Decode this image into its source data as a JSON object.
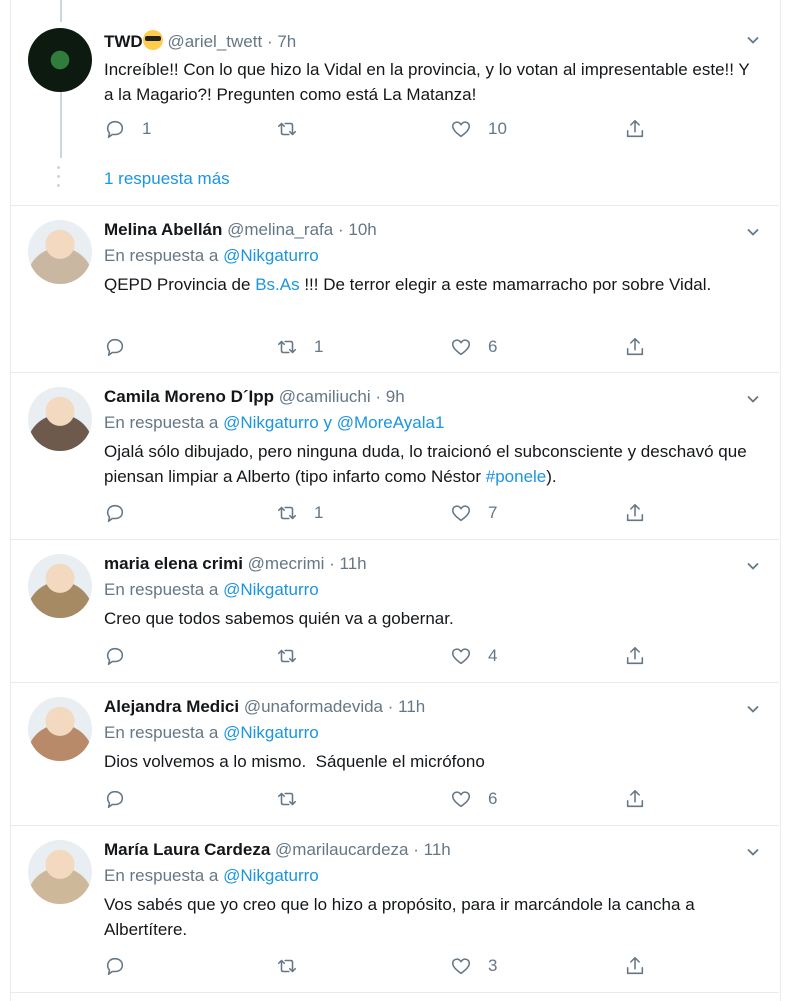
{
  "thread": {
    "more_replies": "1 respuesta más"
  },
  "tweets": [
    {
      "name": "TWD",
      "handle": "@ariel_twett",
      "dot": "·",
      "time": "7h",
      "reply_label": "",
      "reply_to": "",
      "reply_conj": "",
      "reply_to_2": "",
      "text_html": "Increíble!! Con lo que hizo la Vidal en la provincia, y lo votan al impresentable este!! Y a la Magario?! Pregunten como está La Matanza!",
      "replies": "1",
      "retweets": "",
      "likes": "10",
      "avatar_color": "#0e2a14"
    },
    {
      "name": "Melina Abellán",
      "handle": "@melina_rafa",
      "dot": "·",
      "time": "10h",
      "reply_label": "En respuesta a",
      "reply_to": "@Nikgaturro",
      "reply_conj": "",
      "reply_to_2": "",
      "text_html": "QEPD Provincia de <span class=\"link\">Bs.As</span> !!! De terror elegir a este mamarracho por sobre Vidal.",
      "replies": "",
      "retweets": "1",
      "likes": "6",
      "avatar_color": "#c9b7a2"
    },
    {
      "name": "Camila Moreno D´Ipp",
      "handle": "@camiliuchi",
      "dot": "·",
      "time": "9h",
      "reply_label": "En respuesta a",
      "reply_to": "@Nikgaturro",
      "reply_conj": "y",
      "reply_to_2": "@MoreAyala1",
      "text_html": "Ojalá sólo dibujado, pero ninguna duda, lo traicionó el subconsciente y deschavó que piensan limpiar a Alberto (tipo infarto como Néstor <span class=\"link\">#ponele</span>).",
      "replies": "",
      "retweets": "1",
      "likes": "7",
      "avatar_color": "#6d5a4c"
    },
    {
      "name": "maria elena crimi",
      "handle": "@mecrimi",
      "dot": "·",
      "time": "11h",
      "reply_label": "En respuesta a",
      "reply_to": "@Nikgaturro",
      "reply_conj": "",
      "reply_to_2": "",
      "text_html": "Creo que todos sabemos quién va a gobernar.",
      "replies": "",
      "retweets": "",
      "likes": "4",
      "avatar_color": "#a58a63"
    },
    {
      "name": "Alejandra Medici",
      "handle": "@unaformadevida",
      "dot": "·",
      "time": "11h",
      "reply_label": "En respuesta a",
      "reply_to": "@Nikgaturro",
      "reply_conj": "",
      "reply_to_2": "",
      "text_html": "Dios volvemos a lo mismo.&nbsp; Sáquenle el micrófono",
      "replies": "",
      "retweets": "",
      "likes": "6",
      "avatar_color": "#b88a6a"
    },
    {
      "name": "María Laura Cardeza",
      "handle": "@marilaucardeza",
      "dot": "·",
      "time": "11h",
      "reply_label": "En respuesta a",
      "reply_to": "@Nikgaturro",
      "reply_conj": "",
      "reply_to_2": "",
      "text_html": "Vos sabés que yo creo que lo hizo a propósito, para ir marcándole la cancha a Albertítere.",
      "replies": "",
      "retweets": "",
      "likes": "3",
      "avatar_color": "#cdb89a"
    }
  ],
  "colors": {
    "link": "#1b95e0",
    "muted": "#657786",
    "text": "#14171a",
    "border": "#e6ecf0"
  }
}
